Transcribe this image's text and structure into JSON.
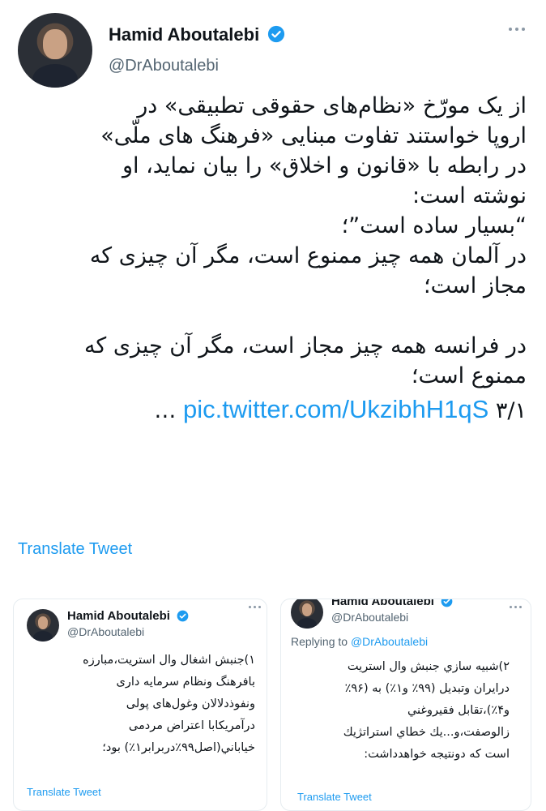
{
  "tweet": {
    "author_name": "Hamid Aboutalebi",
    "author_handle": "@DrAboutalebi",
    "lines": [
      "از یک مورّخ «نظام‌های حقوقی تطبیقی» در",
      "اروپا خواستند تفاوت مبنایی «فرهنگ های ملّی»",
      "در رابطه با «قانون و اخلاق» را بیان نماید، او",
      "نوشته است:",
      "“بسیار ساده است”؛",
      "در آلمان همه چیز ممنوع است، مگر آن چیزی که",
      "مجاز است؛",
      "در فرانسه همه چیز مجاز است، مگر آن چیزی که",
      "ممنوع است؛"
    ],
    "last_line_prefix": "۳/۱ …",
    "link": "pic.twitter.com/UkzibhH1qS",
    "translate_label": "Translate Tweet"
  },
  "cards": {
    "left": {
      "author_name": "Hamid Aboutalebi",
      "author_handle": "@DrAboutalebi",
      "lines": [
        "۱)جنبش اشغال وال استریت،مبارزه",
        "بافرهنگ ونظام سرمایه داری",
        "ونفوذدلالان وغول‌های پولی",
        "درآمریکابا اعتراض مردمی",
        "خیاباني(اصل۹۹٪دربرابر۱٪) بود؛"
      ],
      "translate_label": "Translate Tweet"
    },
    "right": {
      "author_name": "Hamid Aboutalebi",
      "author_handle": "@DrAboutalebi",
      "replying_prefix": "Replying to",
      "replying_handle": "@DrAboutalebi",
      "lines": [
        "۲)شبیه سازي جنبش وال استریت",
        "درایران وتبدیل (۹۹٪ و۱٪) به (۹۶٪",
        "و۴٪)،تقابل فقیروغني",
        "زالوصفت،و...یك خطاي استراتژیك",
        "است که دونتیجه خواهدداشت:"
      ],
      "translate_label": "Translate Tweet"
    }
  },
  "icons": {
    "verified": "verified-badge-icon",
    "more": "more-options-icon"
  },
  "colors": {
    "accent": "#1d9bf0",
    "text": "#0f1419",
    "secondary": "#536471"
  }
}
